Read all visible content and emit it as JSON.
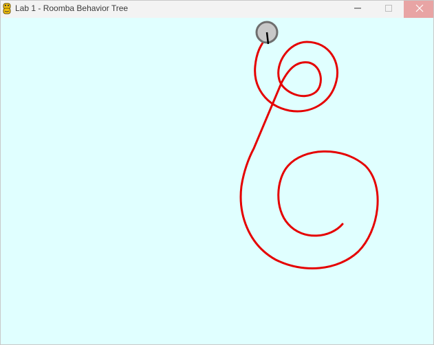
{
  "window": {
    "title": "Lab 1 - Roomba Behavior Tree"
  },
  "icons": {
    "app": "python-snake-icon",
    "minimize": "minimize-icon",
    "maximize": "maximize-icon",
    "close": "close-icon"
  },
  "colors": {
    "background": "#e0ffff",
    "path": "#e50000",
    "robot_body": "#c8c8c8",
    "robot_outline": "#6e6e6e",
    "robot_heading": "#000000"
  }
}
